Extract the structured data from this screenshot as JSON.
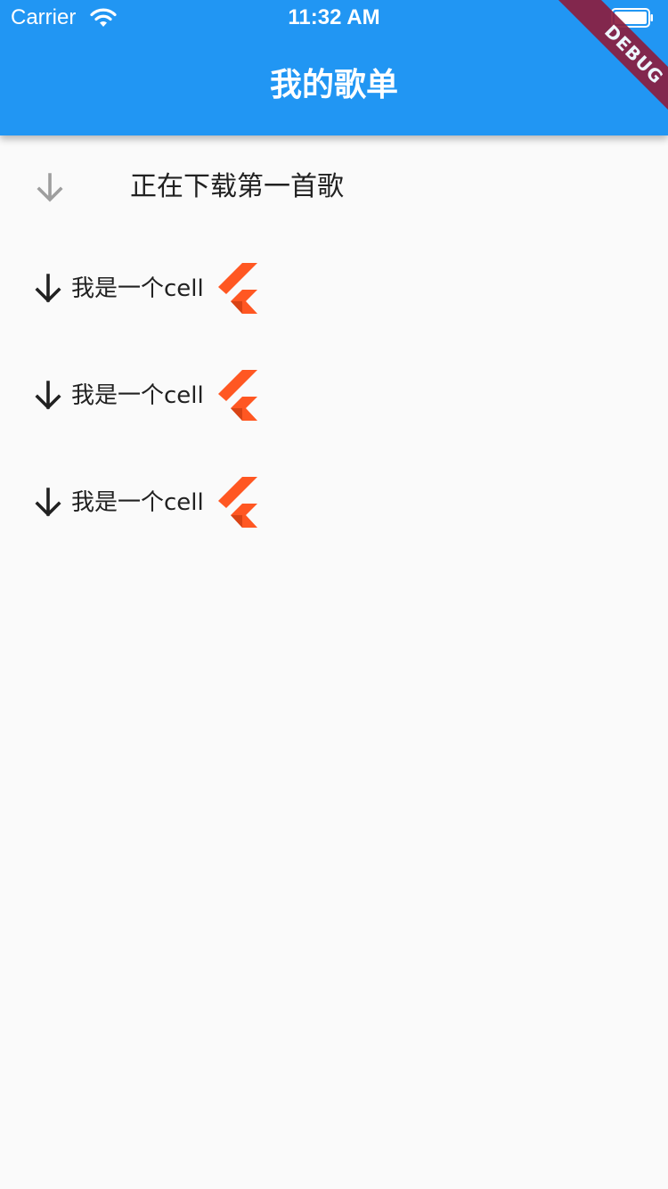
{
  "status_bar": {
    "carrier": "Carrier",
    "time": "11:32 AM",
    "wifi_icon": "wifi-icon",
    "battery_icon": "battery-icon"
  },
  "app_bar": {
    "title": "我的歌单",
    "background": "#2196f3"
  },
  "debug_banner": {
    "text": "DEBUG",
    "color": "#8b1e3f"
  },
  "download_tile": {
    "icon": "download-arrow-icon",
    "text": "正在下载第一首歌"
  },
  "cells": [
    {
      "icon": "arrow-down-icon",
      "label": "我是一个cell",
      "logo": "flutter-logo"
    },
    {
      "icon": "arrow-down-icon",
      "label": "我是一个cell",
      "logo": "flutter-logo"
    },
    {
      "icon": "arrow-down-icon",
      "label": "我是一个cell",
      "logo": "flutter-logo"
    }
  ],
  "colors": {
    "accent": "#2196f3",
    "flutter_orange": "#ff5722",
    "text": "#212121",
    "muted_icon": "#9e9e9e"
  }
}
